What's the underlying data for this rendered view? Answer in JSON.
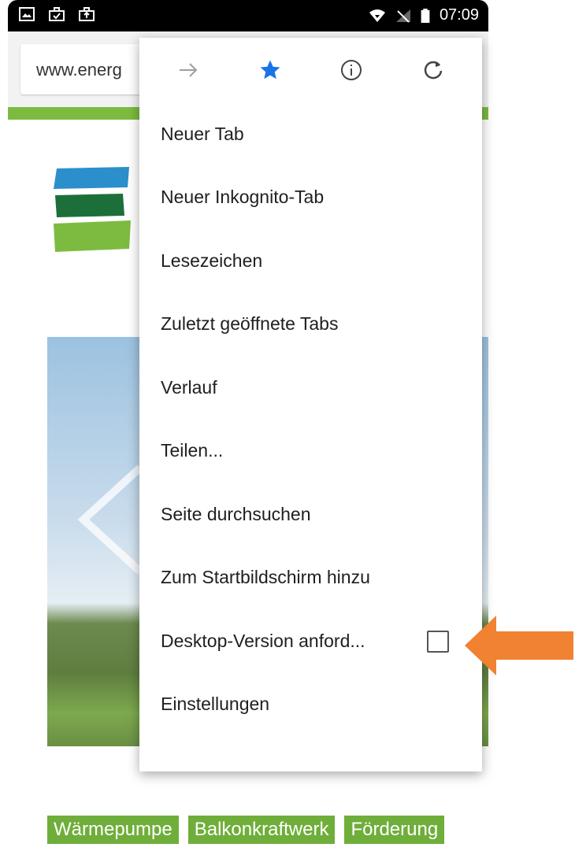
{
  "status_bar": {
    "time": "07:09"
  },
  "browser": {
    "url_text": "www.energ"
  },
  "menu": {
    "items": [
      {
        "label": "Neuer Tab"
      },
      {
        "label": "Neuer Inkognito-Tab"
      },
      {
        "label": "Lesezeichen"
      },
      {
        "label": "Zuletzt geöffnete Tabs"
      },
      {
        "label": "Verlauf"
      },
      {
        "label": "Teilen..."
      },
      {
        "label": "Seite durchsuchen"
      },
      {
        "label": "Zum Startbildschirm hinzu"
      },
      {
        "label": "Desktop-Version anford...",
        "checkbox": false
      },
      {
        "label": "Einstellungen"
      }
    ]
  },
  "page": {
    "tags": [
      "Wärmepumpe",
      "Balkonkraftwerk",
      "Förderung"
    ]
  },
  "colors": {
    "brand_green": "#7dbb40",
    "tag_green": "#6fae3a",
    "bookmark_star": "#1a73e8",
    "annotation_arrow": "#f08232"
  }
}
